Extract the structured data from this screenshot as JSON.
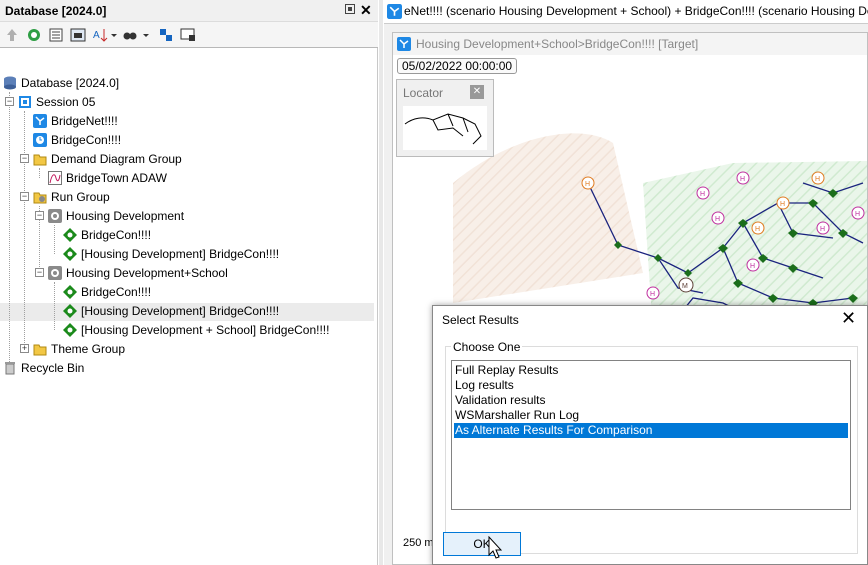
{
  "left_panel": {
    "title": "Database [2024.0]",
    "close_glyph": "✕",
    "toolbar_icons": [
      "up-arrow-icon",
      "refresh-icon",
      "properties-icon",
      "compute-icon",
      "sort-icon",
      "dropdown-icon",
      "find-icon",
      "dropdown-icon",
      "hierarchy-icon",
      "view-icon"
    ]
  },
  "tree": [
    {
      "label": "Database [2024.0]",
      "icon": "database-icon"
    },
    {
      "label": "Session 05",
      "icon": "session-icon"
    },
    {
      "label": "BridgeNet!!!!",
      "icon": "network-icon"
    },
    {
      "label": "BridgeCon!!!!",
      "icon": "control-icon"
    },
    {
      "label": "Demand Diagram Group",
      "icon": "folder-icon"
    },
    {
      "label": "BridgeTown ADAW",
      "icon": "demand-diagram-icon"
    },
    {
      "label": "Run Group",
      "icon": "folder-icon"
    },
    {
      "label": "Housing Development",
      "icon": "run-icon"
    },
    {
      "label": "BridgeCon!!!!",
      "icon": "result-icon"
    },
    {
      "label": "[Housing Development] BridgeCon!!!!",
      "icon": "result-icon"
    },
    {
      "label": "Housing Development+School",
      "icon": "run-icon"
    },
    {
      "label": "BridgeCon!!!!",
      "icon": "result-icon"
    },
    {
      "label": "[Housing Development] BridgeCon!!!!",
      "icon": "result-icon"
    },
    {
      "label": "[Housing Development + School] BridgeCon!!!!",
      "icon": "result-icon"
    },
    {
      "label": "Theme Group",
      "icon": "folder-icon"
    },
    {
      "label": "Recycle Bin",
      "icon": "recycle-bin-icon"
    }
  ],
  "right_panel": {
    "doc_tab": "eNet!!!! (scenario Housing Development + School)  + BridgeCon!!!! (scenario Housing Development + School)",
    "view_title": "Housing Development+School>BridgeCon!!!!  [Target]",
    "timestamp": "05/02/2022 00:00:00",
    "locator_title": "Locator",
    "scale_label": "250 m"
  },
  "dialog": {
    "title": "Select Results",
    "group_label": "Choose One",
    "options": [
      "Full Replay Results",
      "Log results",
      "Validation results",
      "WSMarshaller Run Log",
      "As Alternate Results For Comparison"
    ],
    "selected_option": "As Alternate Results For Comparison",
    "ok_label": "OK"
  },
  "colors": {
    "selection": "#0078d7",
    "pipe": "#1a237e",
    "node": "#1b6e1b",
    "zone_green": "#dff3df",
    "zone_peach": "#f6e6dc"
  }
}
